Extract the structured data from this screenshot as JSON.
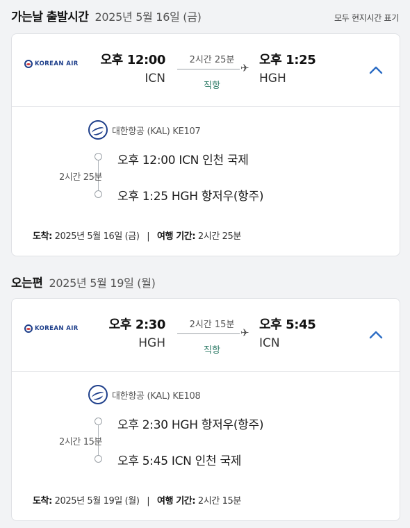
{
  "outbound": {
    "title": "가는날 출발시간",
    "date": "2025년 5월 16일 (금)",
    "note": "모두 현지시간 표기",
    "airline_logo_text": "KOREAN AIR",
    "depart_time": "오후 12:00",
    "depart_code": "ICN",
    "arrive_time": "오후 1:25",
    "arrive_code": "HGH",
    "duration": "2시간 25분",
    "nonstop": "직항",
    "flight_label": "대한항공 (KAL) KE107",
    "timeline_duration": "2시간 25분",
    "stop1": "오후 12:00 ICN 인천 국제",
    "stop2": "오후 1:25 HGH 항저우(항주)",
    "arrival_label": "도착:",
    "arrival_value": "2025년 5월 16일 (금)",
    "separator": "|",
    "trip_label": "여행 기간:",
    "trip_value": "2시간 25분"
  },
  "inbound": {
    "title": "오는편",
    "date": "2025년 5월 19일 (월)",
    "airline_logo_text": "KOREAN AIR",
    "depart_time": "오후 2:30",
    "depart_code": "HGH",
    "arrive_time": "오후 5:45",
    "arrive_code": "ICN",
    "duration": "2시간 15분",
    "nonstop": "직항",
    "flight_label": "대한항공 (KAL) KE108",
    "timeline_duration": "2시간 15분",
    "stop1": "오후 2:30 HGH 항저우(항주)",
    "stop2": "오후 5:45 ICN 인천 국제",
    "arrival_label": "도착:",
    "arrival_value": "2025년 5월 19일 (월)",
    "separator": "|",
    "trip_label": "여행 기간:",
    "trip_value": "2시간 15분"
  },
  "icons": {
    "plane": "airplane-icon",
    "chevron": "chevron-up-icon",
    "airline": "korean-air-logo-icon"
  },
  "colors": {
    "brand_blue": "#1d3e8a",
    "chevron_blue": "#2b6cc4",
    "nonstop_green": "#2d7a66"
  }
}
